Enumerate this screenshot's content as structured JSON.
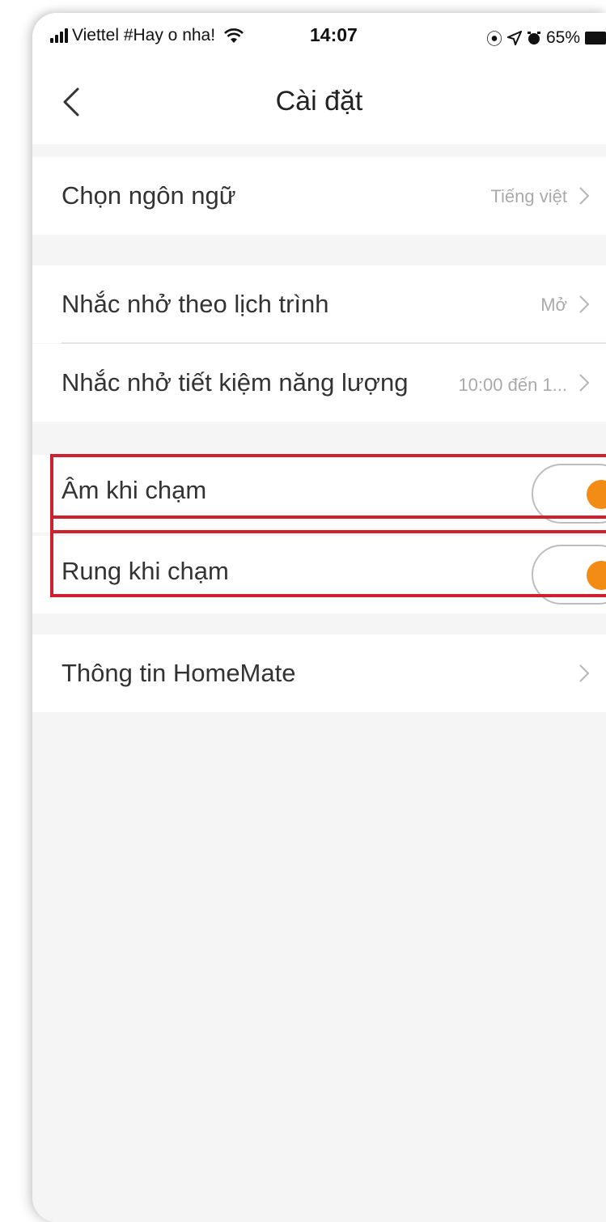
{
  "status_bar": {
    "carrier": "Viettel #Hay o nha!",
    "time": "14:07",
    "battery": "65%",
    "icons": [
      "signal-icon",
      "wifi-icon",
      "lock-rotation-icon",
      "location-icon",
      "alarm-icon",
      "battery-icon"
    ]
  },
  "header": {
    "title": "Cài đặt",
    "back_icon": "chevron-left-icon"
  },
  "settings": {
    "language": {
      "label": "Chọn ngôn ngữ",
      "value": "Tiếng việt"
    },
    "schedule_reminder": {
      "label": "Nhắc nhở theo lịch trình",
      "value": "Mở"
    },
    "energy_reminder": {
      "label": "Nhắc nhở tiết kiệm năng lượng",
      "value": "10:00 đến 1..."
    },
    "touch_sound": {
      "label": "Âm khi chạm",
      "enabled": true
    },
    "touch_vibrate": {
      "label": "Rung khi chạm",
      "enabled": true
    },
    "about": {
      "label": "Thông tin HomeMate"
    }
  },
  "colors": {
    "accent": "#f28c14",
    "highlight_border": "#d0202e",
    "background": "#f5f5f5"
  }
}
